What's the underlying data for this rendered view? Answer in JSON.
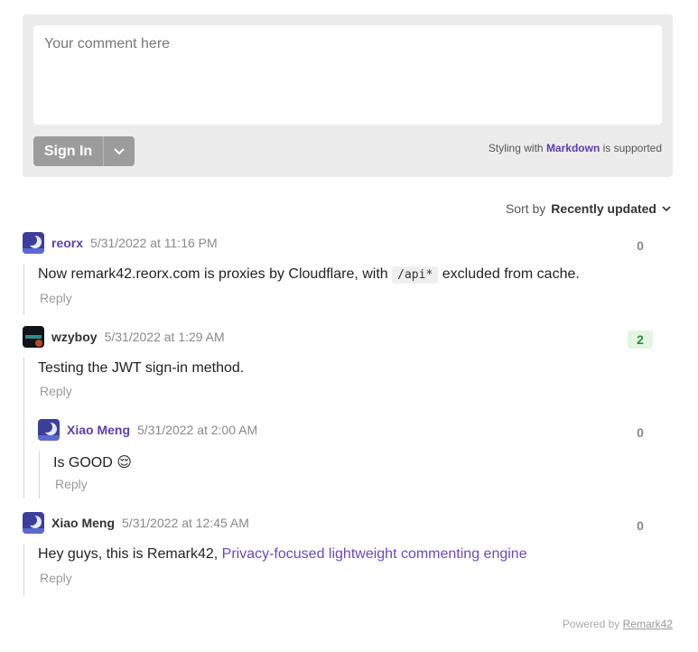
{
  "editor": {
    "placeholder": "Your comment here",
    "signin_label": "Sign In",
    "styling_prefix": "Styling with",
    "markdown_link": "Markdown",
    "styling_suffix": "is supported"
  },
  "sort": {
    "label": "Sort by",
    "value": "Recently updated"
  },
  "comments": [
    {
      "author": "reorx",
      "date": "5/31/2022 at 11:16 PM",
      "text_before": "Now remark42.reorx.com is proxies by Cloudflare, with",
      "code": "/api*",
      "text_after": "excluded from cache.",
      "reply": "Reply",
      "score": "0"
    },
    {
      "author": "wzyboy",
      "date": "5/31/2022 at 1:29 AM",
      "text": "Testing the JWT sign-in method.",
      "reply": "Reply",
      "score": "2",
      "replies": [
        {
          "author": "Xiao Meng",
          "date": "5/31/2022 at 2:00 AM",
          "text": "Is GOOD",
          "emoji": "😌",
          "reply": "Reply",
          "score": "0"
        }
      ]
    },
    {
      "author": "Xiao Meng",
      "date": "5/31/2022 at 12:45 AM",
      "text": "Hey guys, this is Remark42,",
      "link": "Privacy-focused lightweight commenting engine",
      "reply": "Reply",
      "score": "0"
    }
  ],
  "footer": {
    "powered_by": "Powered by",
    "remark42": "Remark42"
  }
}
